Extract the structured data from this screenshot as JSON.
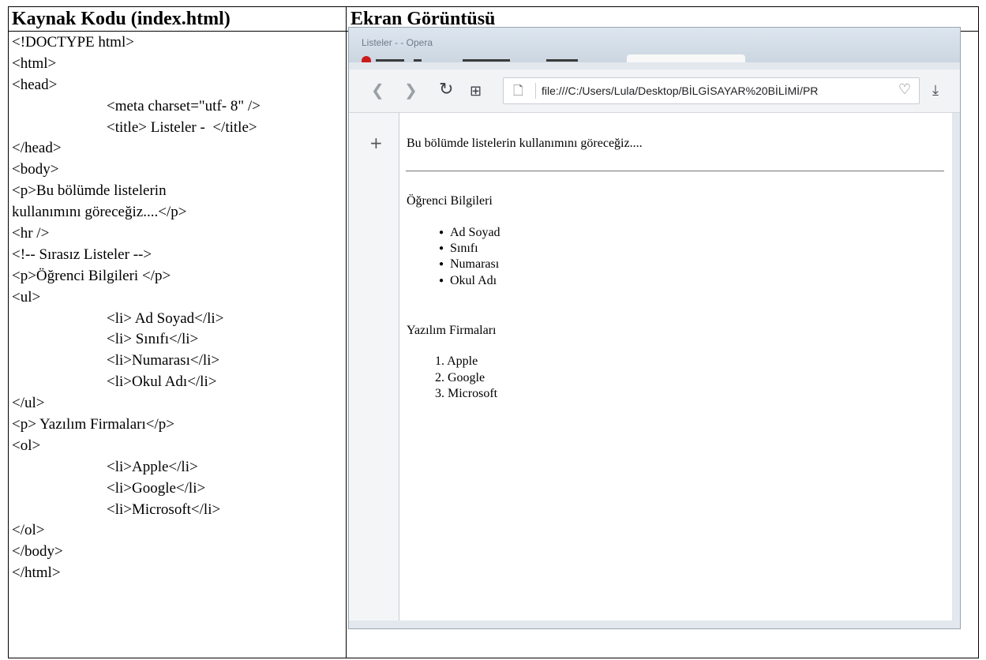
{
  "headers": {
    "source_title": "Kaynak Kodu (index.html)",
    "screenshot_title": "Ekran Görüntüsü"
  },
  "code_lines": [
    {
      "text": "<!DOCTYPE html>",
      "indent": false
    },
    {
      "text": "<html>",
      "indent": false
    },
    {
      "text": "<head>",
      "indent": false
    },
    {
      "text": "<meta charset=\"utf- 8\" />",
      "indent": true
    },
    {
      "text": "<title> Listeler -  </title>",
      "indent": true
    },
    {
      "text": "</head>",
      "indent": false
    },
    {
      "text": "<body>",
      "indent": false
    },
    {
      "text": "<p>Bu bölümde listelerin",
      "indent": false
    },
    {
      "text": "kullanımını göreceğiz....</p>",
      "indent": false
    },
    {
      "text": "<hr />",
      "indent": false
    },
    {
      "text": "<!-- Sırasız Listeler -->",
      "indent": false
    },
    {
      "text": "<p>Öğrenci Bilgileri </p>",
      "indent": false
    },
    {
      "text": "<ul>",
      "indent": false
    },
    {
      "text": "<li> Ad Soyad</li>",
      "indent": true
    },
    {
      "text": "<li> Sınıfı</li>",
      "indent": true
    },
    {
      "text": "<li>Numarası</li>",
      "indent": true
    },
    {
      "text": "<li>Okul Adı</li>",
      "indent": true
    },
    {
      "text": "</ul>",
      "indent": false
    },
    {
      "text": "<p> Yazılım Firmaları</p>",
      "indent": false
    },
    {
      "text": "<ol>",
      "indent": false
    },
    {
      "text": "<li>Apple</li>",
      "indent": true
    },
    {
      "text": "<li>Google</li>",
      "indent": true
    },
    {
      "text": "<li>Microsoft</li>",
      "indent": true
    },
    {
      "text": "</ol>",
      "indent": false
    },
    {
      "text": "</body>",
      "indent": false
    },
    {
      "text": "</html>",
      "indent": false
    }
  ],
  "browser": {
    "window_title": "Listeler - - Opera",
    "url": "file:///C:/Users/Lula/Desktop/BİLGİSAYAR%20BİLİMİ/PR",
    "icons": {
      "back": "back-arrow-icon",
      "forward": "forward-arrow-icon",
      "reload": "reload-icon",
      "grid": "speed-dial-icon",
      "page": "page-icon",
      "heart": "heart-icon",
      "download": "download-icon",
      "plus": "plus-icon"
    }
  },
  "page": {
    "intro": "Bu bölümde listelerin kullanımını göreceğiz....",
    "students_heading": "Öğrenci Bilgileri",
    "students_items": [
      "Ad Soyad",
      "Sınıfı",
      "Numarası",
      "Okul Adı"
    ],
    "companies_heading": "Yazılım Firmaları",
    "companies_items": [
      "Apple",
      "Google",
      "Microsoft"
    ]
  }
}
